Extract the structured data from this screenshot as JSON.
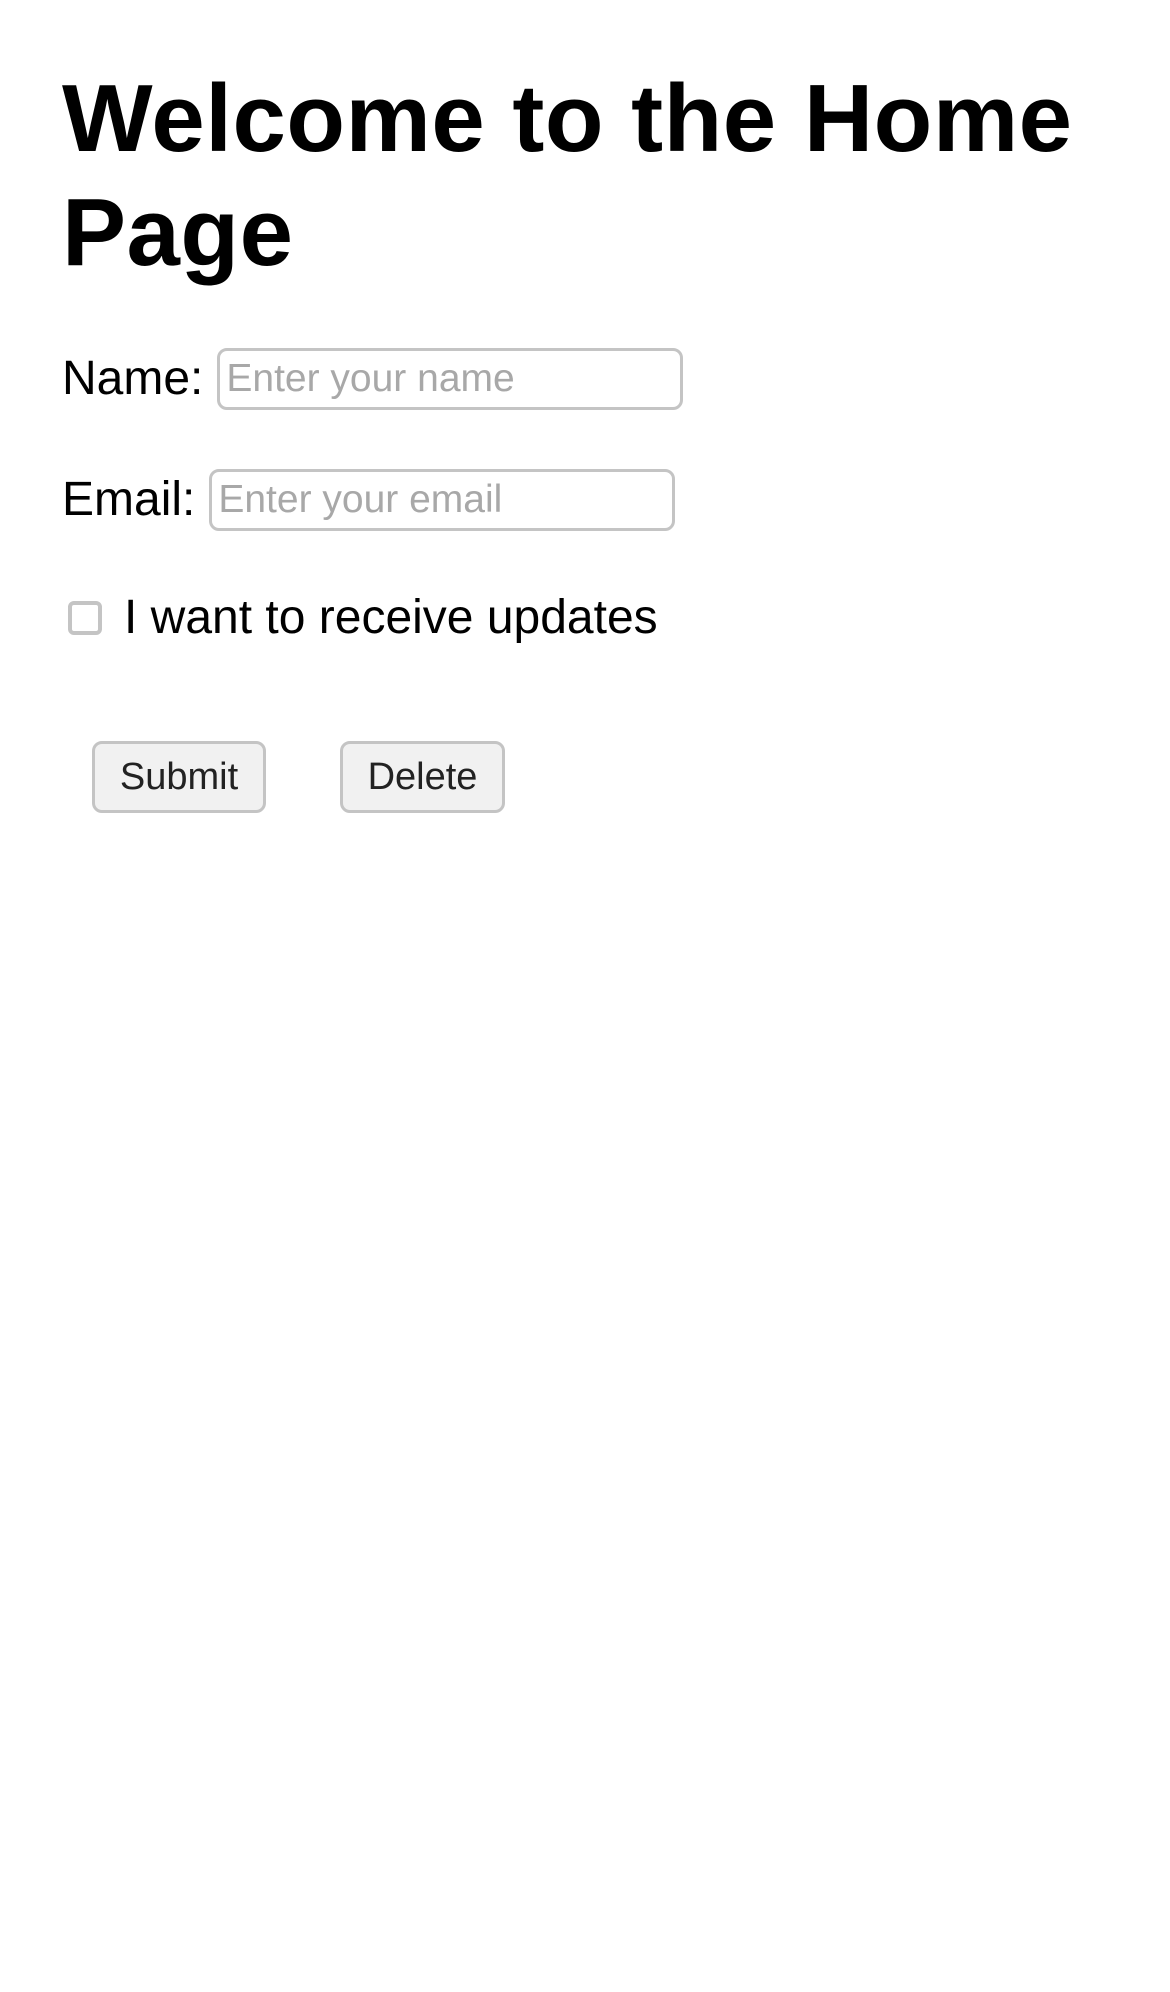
{
  "page": {
    "title": "Welcome to the Home Page"
  },
  "form": {
    "name": {
      "label": "Name:",
      "placeholder": "Enter your name",
      "value": ""
    },
    "email": {
      "label": "Email:",
      "placeholder": "Enter your email",
      "value": ""
    },
    "updates": {
      "label": "I want to receive updates",
      "checked": false
    },
    "buttons": {
      "submit_label": "Submit",
      "delete_label": "Delete"
    }
  }
}
